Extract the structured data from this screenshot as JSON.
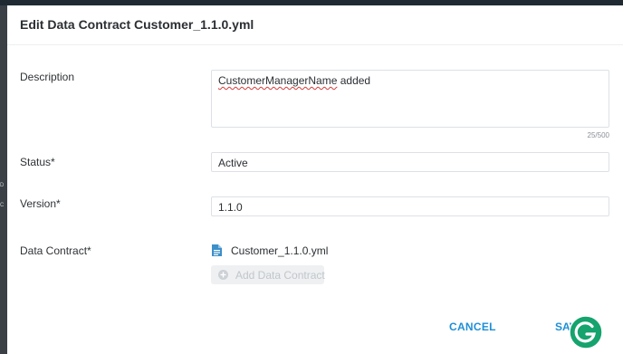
{
  "dialog": {
    "title": "Edit Data Contract Customer_1.1.0.yml"
  },
  "form": {
    "description": {
      "label": "Description",
      "value_misspelled": "CustomerManagerName",
      "value_rest": " added",
      "counter": "25/500"
    },
    "status": {
      "label": "Status*",
      "value": "Active"
    },
    "version": {
      "label": "Version*",
      "value": "1.1.0"
    },
    "data_contract": {
      "label": "Data Contract*",
      "file_name": "Customer_1.1.0.yml",
      "add_label": "Add Data Contract"
    }
  },
  "actions": {
    "cancel_label": "CANCEL",
    "save_label": "SAVE"
  },
  "background_fragments": [
    "D",
    "C"
  ],
  "icons": {
    "file": "document-icon",
    "add": "plus-circle-icon",
    "grammarly": "grammarly-icon"
  },
  "colors": {
    "accent": "#1e8fd6",
    "file_icon": "#3d8fc9",
    "grammarly": "#15a36e",
    "disabled_text": "#c2c6ca"
  }
}
